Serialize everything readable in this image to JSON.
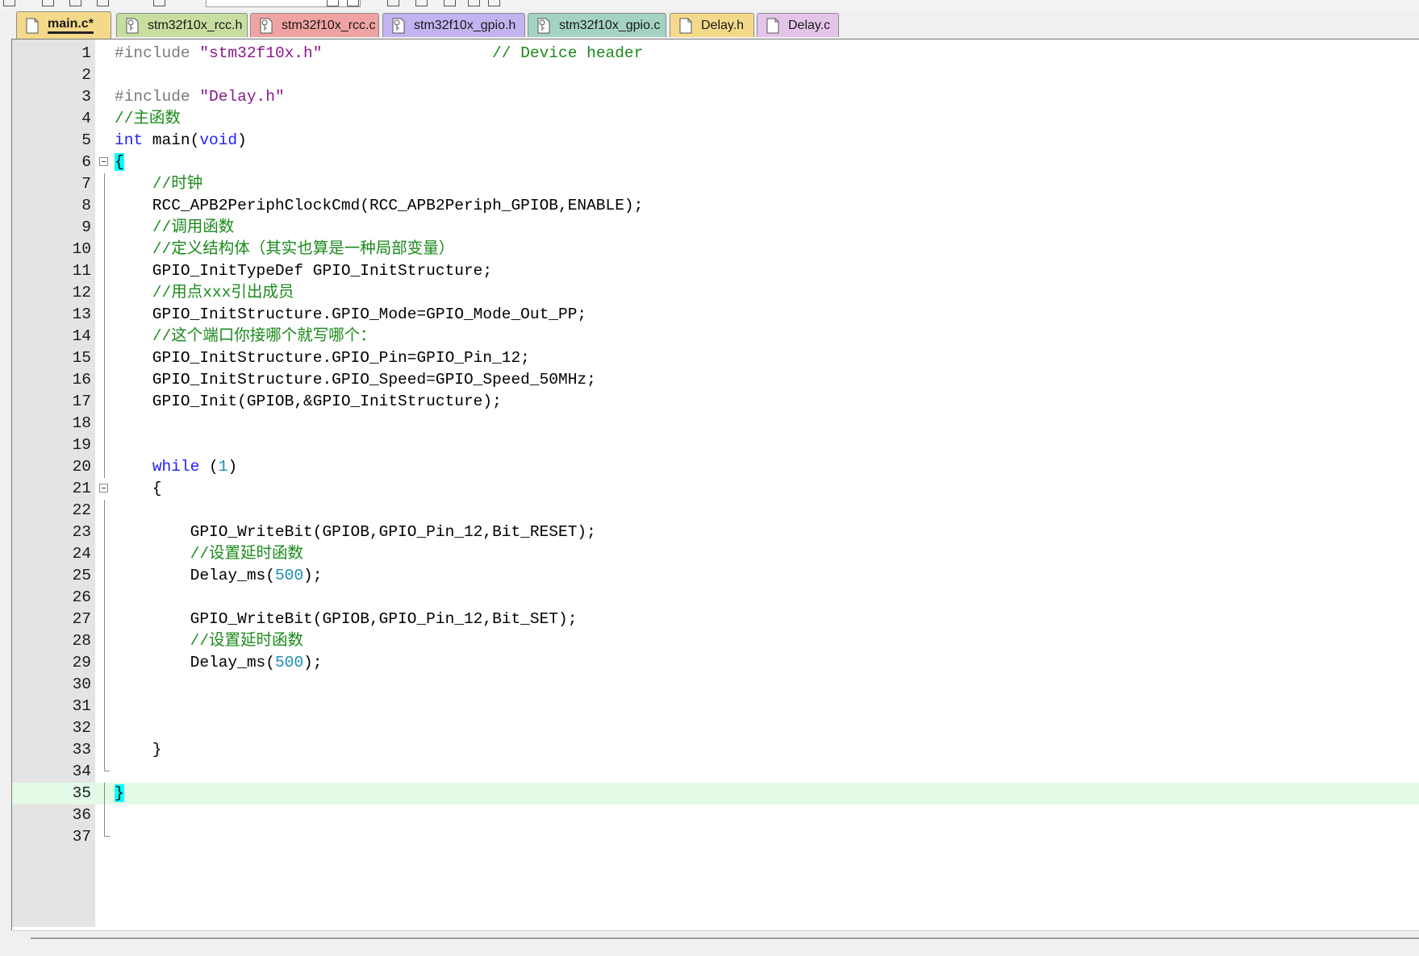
{
  "tabs": [
    {
      "label": "main.c*",
      "kind": "file",
      "active": true,
      "color": "#f5d98a"
    },
    {
      "label": "stm32f10x_rcc.h",
      "kind": "key",
      "active": false,
      "color": "#c7dea0"
    },
    {
      "label": "stm32f10x_rcc.c",
      "kind": "key",
      "active": false,
      "color": "#f0a3a3"
    },
    {
      "label": "stm32f10x_gpio.h",
      "kind": "key",
      "active": false,
      "color": "#c3b3f0"
    },
    {
      "label": "stm32f10x_gpio.c",
      "kind": "key",
      "active": false,
      "color": "#a5d3c2"
    },
    {
      "label": "Delay.h",
      "kind": "file",
      "active": false,
      "color": "#f5d98a"
    },
    {
      "label": "Delay.c",
      "kind": "file",
      "active": false,
      "color": "#e4c5e9"
    }
  ],
  "colors": {
    "keyword": "#2020ff",
    "number": "#1a8fb5",
    "string": "#8a1a8a",
    "preprocessor": "#7a7a7a",
    "comment": "#1a8a1a",
    "current_line": "#e3fae6",
    "brace_match": "#00ffff"
  },
  "code_lines": [
    {
      "n": "1",
      "segs": [
        [
          "pp",
          "#include "
        ],
        [
          "str",
          "\"stm32f10x.h\""
        ],
        [
          "t",
          "                  "
        ],
        [
          "cm",
          "// Device header"
        ]
      ]
    },
    {
      "n": "2",
      "segs": []
    },
    {
      "n": "3",
      "segs": [
        [
          "pp",
          "#include "
        ],
        [
          "str",
          "\"Delay.h\""
        ]
      ]
    },
    {
      "n": "4",
      "segs": [
        [
          "cm",
          "//主函数"
        ]
      ]
    },
    {
      "n": "5",
      "segs": [
        [
          "kw",
          "int"
        ],
        [
          "t",
          " main("
        ],
        [
          "kw",
          "void"
        ],
        [
          "t",
          ")"
        ]
      ]
    },
    {
      "n": "6",
      "fold": "open",
      "segs": [
        [
          "hl",
          "{"
        ]
      ]
    },
    {
      "n": "7",
      "fold": "line",
      "segs": [
        [
          "t",
          "    "
        ],
        [
          "cm",
          "//时钟"
        ]
      ]
    },
    {
      "n": "8",
      "fold": "line",
      "segs": [
        [
          "t",
          "    RCC_APB2PeriphClockCmd(RCC_APB2Periph_GPIOB,ENABLE);"
        ]
      ]
    },
    {
      "n": "9",
      "fold": "line",
      "segs": [
        [
          "t",
          "    "
        ],
        [
          "cm",
          "//调用函数"
        ]
      ]
    },
    {
      "n": "10",
      "fold": "line",
      "segs": [
        [
          "t",
          "    "
        ],
        [
          "cm",
          "//定义结构体（其实也算是一种局部变量）"
        ]
      ]
    },
    {
      "n": "11",
      "fold": "line",
      "segs": [
        [
          "t",
          "    GPIO_InitTypeDef GPIO_InitStructure;"
        ]
      ]
    },
    {
      "n": "12",
      "fold": "line",
      "segs": [
        [
          "t",
          "    "
        ],
        [
          "cm",
          "//用点xxx引出成员"
        ]
      ]
    },
    {
      "n": "13",
      "fold": "line",
      "segs": [
        [
          "t",
          "    GPIO_InitStructure.GPIO_Mode=GPIO_Mode_Out_PP;"
        ]
      ]
    },
    {
      "n": "14",
      "fold": "line",
      "segs": [
        [
          "t",
          "    "
        ],
        [
          "cm",
          "//这个端口你接哪个就写哪个："
        ]
      ]
    },
    {
      "n": "15",
      "fold": "line",
      "segs": [
        [
          "t",
          "    GPIO_InitStructure.GPIO_Pin=GPIO_Pin_12;"
        ]
      ]
    },
    {
      "n": "16",
      "fold": "line",
      "segs": [
        [
          "t",
          "    GPIO_InitStructure.GPIO_Speed=GPIO_Speed_50MHz;"
        ]
      ]
    },
    {
      "n": "17",
      "fold": "line",
      "segs": [
        [
          "t",
          "    GPIO_Init(GPIOB,&GPIO_InitStructure);"
        ]
      ]
    },
    {
      "n": "18",
      "fold": "line",
      "segs": []
    },
    {
      "n": "19",
      "fold": "line",
      "segs": []
    },
    {
      "n": "20",
      "fold": "line",
      "segs": [
        [
          "t",
          "    "
        ],
        [
          "kw",
          "while"
        ],
        [
          "t",
          " ("
        ],
        [
          "num",
          "1"
        ],
        [
          "t",
          ")"
        ]
      ]
    },
    {
      "n": "21",
      "fold": "open",
      "segs": [
        [
          "t",
          "    {"
        ]
      ]
    },
    {
      "n": "22",
      "fold": "line",
      "segs": []
    },
    {
      "n": "23",
      "fold": "line",
      "segs": [
        [
          "t",
          "        GPIO_WriteBit(GPIOB,GPIO_Pin_12,Bit_RESET);"
        ]
      ]
    },
    {
      "n": "24",
      "fold": "line",
      "segs": [
        [
          "t",
          "        "
        ],
        [
          "cm",
          "//设置延时函数"
        ]
      ]
    },
    {
      "n": "25",
      "fold": "line",
      "segs": [
        [
          "t",
          "        Delay_ms("
        ],
        [
          "num",
          "500"
        ],
        [
          "t",
          ");"
        ]
      ]
    },
    {
      "n": "26",
      "fold": "line",
      "segs": []
    },
    {
      "n": "27",
      "fold": "line",
      "segs": [
        [
          "t",
          "        GPIO_WriteBit(GPIOB,GPIO_Pin_12,Bit_SET);"
        ]
      ]
    },
    {
      "n": "28",
      "fold": "line",
      "segs": [
        [
          "t",
          "        "
        ],
        [
          "cm",
          "//设置延时函数"
        ]
      ]
    },
    {
      "n": "29",
      "fold": "line",
      "segs": [
        [
          "t",
          "        Delay_ms("
        ],
        [
          "num",
          "500"
        ],
        [
          "t",
          ");"
        ]
      ]
    },
    {
      "n": "30",
      "fold": "line",
      "segs": []
    },
    {
      "n": "31",
      "fold": "line",
      "segs": []
    },
    {
      "n": "32",
      "fold": "line",
      "segs": []
    },
    {
      "n": "33",
      "fold": "line",
      "segs": [
        [
          "t",
          "    }"
        ]
      ]
    },
    {
      "n": "34",
      "fold": "end",
      "segs": []
    },
    {
      "n": "35",
      "current": true,
      "fold": "line",
      "segs": [
        [
          "hl",
          "}"
        ]
      ]
    },
    {
      "n": "36",
      "fold": "line",
      "segs": []
    },
    {
      "n": "37",
      "fold": "end",
      "segs": []
    }
  ]
}
